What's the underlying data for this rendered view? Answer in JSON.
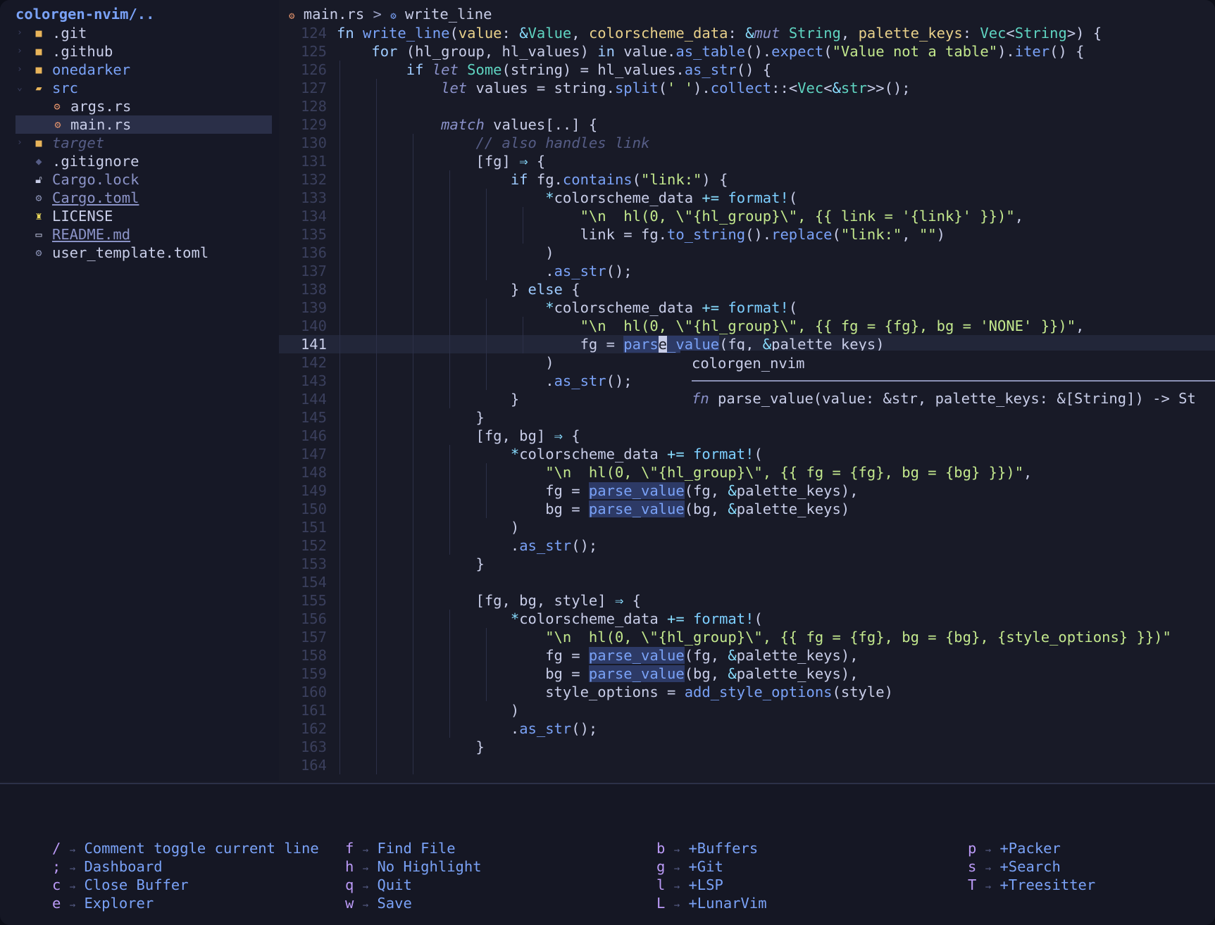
{
  "sidebar": {
    "title": "colorgen-nvim/..",
    "items": [
      {
        "name": ".git",
        "icon": "folder-icon"
      },
      {
        "name": ".github",
        "icon": "folder-icon"
      },
      {
        "name": "onedarker",
        "icon": "folder-icon"
      },
      {
        "name": "src",
        "icon": "folder-open-icon"
      },
      {
        "name": "args.rs",
        "icon": "rust-icon"
      },
      {
        "name": "main.rs",
        "icon": "rust-icon"
      },
      {
        "name": "target",
        "icon": "folder-icon"
      },
      {
        "name": ".gitignore",
        "icon": "git-icon"
      },
      {
        "name": "Cargo.lock",
        "icon": "lock-icon"
      },
      {
        "name": "Cargo.toml",
        "icon": "gear-icon"
      },
      {
        "name": "LICENSE",
        "icon": "license-icon"
      },
      {
        "name": "README.md",
        "icon": "markdown-icon"
      },
      {
        "name": "user_template.toml",
        "icon": "gear-icon"
      }
    ]
  },
  "breadcrumb": {
    "file": "main.rs",
    "separator": ">",
    "symbol": "write_line"
  },
  "editor": {
    "line_numbers": [
      "124",
      "125",
      "126",
      "127",
      "128",
      "129",
      "130",
      "131",
      "132",
      "133",
      "134",
      "135",
      "136",
      "137",
      "138",
      "139",
      "140",
      "141",
      "142",
      "143",
      "144",
      "145",
      "146",
      "147",
      "148",
      "149",
      "150",
      "151",
      "152",
      "153",
      "154",
      "155",
      "156",
      "157",
      "158",
      "159",
      "160",
      "161",
      "162",
      "163",
      "164"
    ],
    "current_line": "141"
  },
  "hover": {
    "crate": "colorgen_nvim",
    "signature_kw": "fn",
    "signature": "parse_value(value: &str, palette_keys: &[String]) -> St"
  },
  "whichkey": {
    "columns": [
      [
        {
          "key": "/",
          "desc": "Comment toggle current line"
        },
        {
          "key": ";",
          "desc": "Dashboard"
        },
        {
          "key": "c",
          "desc": "Close Buffer"
        },
        {
          "key": "e",
          "desc": "Explorer"
        }
      ],
      [
        {
          "key": "f",
          "desc": "Find File"
        },
        {
          "key": "h",
          "desc": "No Highlight"
        },
        {
          "key": "q",
          "desc": "Quit"
        },
        {
          "key": "w",
          "desc": "Save"
        }
      ],
      [
        {
          "key": "b",
          "desc": "+Buffers"
        },
        {
          "key": "g",
          "desc": "+Git"
        },
        {
          "key": "l",
          "desc": "+LSP"
        },
        {
          "key": "L",
          "desc": "+LunarVim"
        }
      ],
      [
        {
          "key": "p",
          "desc": "+Packer"
        },
        {
          "key": "s",
          "desc": "+Search"
        },
        {
          "key": "T",
          "desc": "+Treesitter"
        }
      ]
    ]
  },
  "colors": {
    "background": "#181a27",
    "accent": "#7aa2f7",
    "keyword": "#bb9af7",
    "string": "#c3e88d"
  }
}
